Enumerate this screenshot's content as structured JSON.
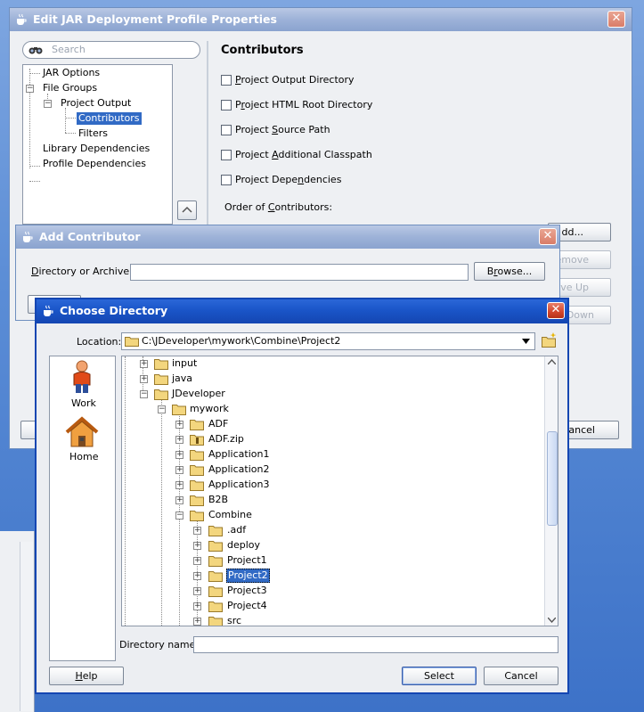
{
  "jar_dialog": {
    "title": "Edit JAR Deployment Profile Properties",
    "search_placeholder": "Search",
    "nav": [
      "JAR Options",
      "File Groups",
      "Project Output",
      "Contributors",
      "Filters",
      "Library Dependencies",
      "Profile Dependencies"
    ],
    "section_title": "Contributors",
    "options": [
      {
        "pre": "",
        "ul": "P",
        "post": "roject Output Directory"
      },
      {
        "pre": "P",
        "ul": "r",
        "post": "oject HTML Root Directory"
      },
      {
        "pre": "Project ",
        "ul": "S",
        "post": "ource Path"
      },
      {
        "pre": "Project ",
        "ul": "A",
        "post": "dditional Classpath"
      },
      {
        "pre": "Project Depe",
        "ul": "n",
        "post": "dencies"
      }
    ],
    "order_label_pre": "Order of ",
    "order_label_ul": "C",
    "order_label_post": "ontributors:",
    "side_buttons": {
      "add": "dd...",
      "remove": "emove",
      "move_up": "ve Up",
      "move_down": "Down"
    },
    "cancel_partial": "ancel"
  },
  "add_dialog": {
    "title": "Add Contributor",
    "field_label_ul": "D",
    "field_label_post": "irectory or Archive:",
    "field_value": "",
    "browse_pre": "B",
    "browse_ul": "r",
    "browse_post": "owse..."
  },
  "choose_dialog": {
    "title": "Choose Directory",
    "location_label": "Location:",
    "location_value": "C:\\JDeveloper\\mywork\\Combine\\Project2",
    "places": [
      {
        "label": "Work",
        "icon": "person-icon"
      },
      {
        "label": "Home",
        "icon": "house-icon"
      }
    ],
    "tree": [
      {
        "label": "input"
      },
      {
        "label": "java"
      },
      {
        "label": "JDeveloper"
      },
      {
        "label": "mywork"
      },
      {
        "label": "ADF"
      },
      {
        "label": "ADF.zip"
      },
      {
        "label": "Application1"
      },
      {
        "label": "Application2"
      },
      {
        "label": "Application3"
      },
      {
        "label": "B2B"
      },
      {
        "label": "Combine"
      },
      {
        "label": ".adf"
      },
      {
        "label": "deploy"
      },
      {
        "label": "Project1"
      },
      {
        "label": "Project2"
      },
      {
        "label": "Project3"
      },
      {
        "label": "Project4"
      },
      {
        "label": "src"
      }
    ],
    "dirname_label": "Directory name:",
    "dirname_value": "",
    "help_pre": "",
    "help_ul": "H",
    "help_post": "elp",
    "select_label": "Select",
    "cancel_label": "Cancel"
  }
}
